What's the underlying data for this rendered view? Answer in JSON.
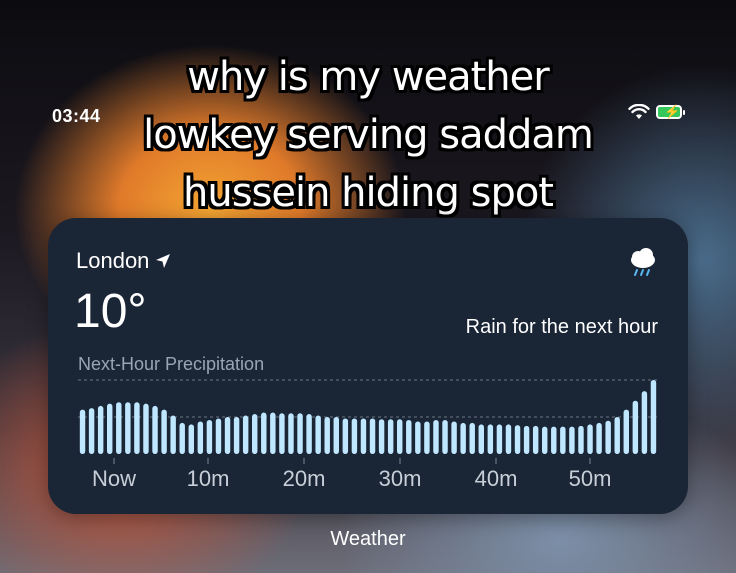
{
  "status_bar": {
    "time": "03:44"
  },
  "caption": {
    "line1": "why is my weather",
    "line2": "lowkey serving saddam",
    "line3": "hussein hiding spot"
  },
  "widget": {
    "city": "London",
    "temperature": "10°",
    "summary": "Rain for the next hour",
    "section_title": "Next-Hour Precipitation",
    "icons": {
      "location": "location-arrow-icon",
      "condition": "cloud-rain-icon"
    },
    "colors": {
      "background": "#1a2536",
      "bar": "#bfe7ff",
      "gridline": "#5a6676"
    }
  },
  "app_label": "Weather",
  "chart_data": {
    "type": "bar",
    "x_ticks": [
      "Now",
      "10m",
      "20m",
      "30m",
      "40m",
      "50m"
    ],
    "values": [
      0.6,
      0.62,
      0.65,
      0.68,
      0.7,
      0.7,
      0.7,
      0.68,
      0.65,
      0.6,
      0.52,
      0.42,
      0.4,
      0.44,
      0.46,
      0.48,
      0.5,
      0.5,
      0.52,
      0.54,
      0.56,
      0.56,
      0.55,
      0.55,
      0.55,
      0.54,
      0.52,
      0.5,
      0.5,
      0.48,
      0.48,
      0.48,
      0.48,
      0.47,
      0.47,
      0.47,
      0.46,
      0.44,
      0.44,
      0.46,
      0.46,
      0.44,
      0.42,
      0.42,
      0.4,
      0.4,
      0.4,
      0.4,
      0.39,
      0.38,
      0.38,
      0.37,
      0.37,
      0.37,
      0.37,
      0.38,
      0.4,
      0.42,
      0.45,
      0.5,
      0.6,
      0.72,
      0.85,
      1.0
    ],
    "ylim": [
      0,
      1
    ],
    "grid": true
  }
}
